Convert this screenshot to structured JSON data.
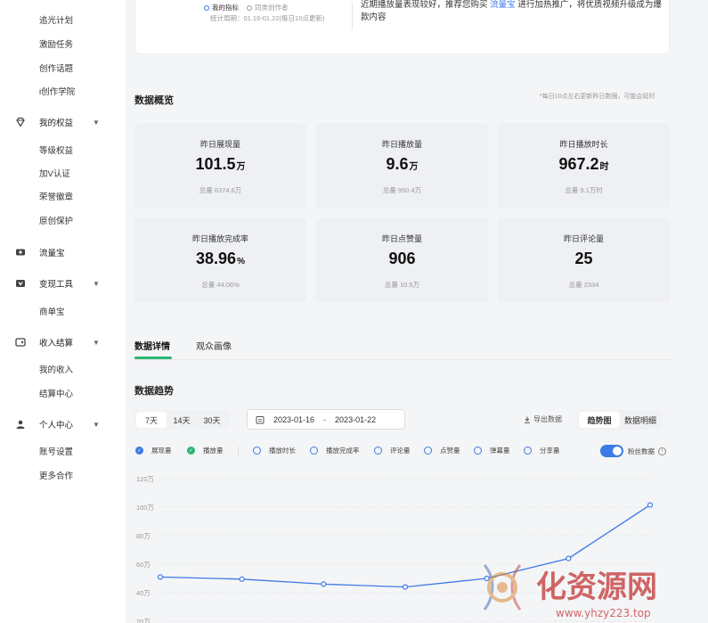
{
  "sidebar": {
    "items_top": [
      "追光计划",
      "激励任务",
      "创作话题",
      "i创作学院"
    ],
    "group_rights": "我的权益",
    "rights_items": [
      "等级权益",
      "加V认证",
      "荣誉徽章",
      "原创保护"
    ],
    "group_traffic": "流量宝",
    "group_monetize": "变现工具",
    "monetize_items": [
      "商单宝"
    ],
    "group_income": "收入结算",
    "income_items": [
      "我的收入",
      "结算中心"
    ],
    "group_personal": "个人中心",
    "personal_items": [
      "账号设置",
      "更多合作"
    ]
  },
  "top_card": {
    "option_mine": "我的指标",
    "option_peer": "同类创作者",
    "stat_period": "统计周期：01.16-01.22(每日10点更新)",
    "tip_prefix": "近期播放量表现较好，推荐您购买",
    "tip_link": "流量宝",
    "tip_suffix": "进行加热推广，将优质视频升级成为爆款内容"
  },
  "overview": {
    "title": "数据概览",
    "note": "*每日10点左右更新昨日数据，可能会延时",
    "metrics": [
      {
        "label": "昨日展现量",
        "value": "101.5",
        "unit": "万",
        "sub": "总量 6374.6万"
      },
      {
        "label": "昨日播放量",
        "value": "9.6",
        "unit": "万",
        "sub": "总量 950.4万"
      },
      {
        "label": "昨日播放时长",
        "value": "967.2",
        "unit": "时",
        "sub": "总量 9.1万时"
      },
      {
        "label": "昨日播放完成率",
        "value": "38.96",
        "unit": "%",
        "sub": "总量 44.06%"
      },
      {
        "label": "昨日点赞量",
        "value": "906",
        "unit": "",
        "sub": "总量 10.5万"
      },
      {
        "label": "昨日评论量",
        "value": "25",
        "unit": "",
        "sub": "总量 2334"
      }
    ]
  },
  "tabs": [
    "数据详情",
    "观众画像"
  ],
  "trend": {
    "title": "数据趋势",
    "ranges": [
      "7天",
      "14天",
      "30天"
    ],
    "date_start": "2023-01-16",
    "date_sep": "-",
    "date_end": "2023-01-22",
    "export": "导出数据",
    "views": [
      "趋势图",
      "数据明细"
    ],
    "metric_toggles": [
      "展现量",
      "播放量",
      "播放时长",
      "播放完成率",
      "评论量",
      "点赞量",
      "弹幕量",
      "分享量"
    ],
    "fan_data": "粉丝数据"
  },
  "colors": {
    "accent": "#3d7ae6",
    "green": "#2bb673"
  },
  "watermark": {
    "text": "化资源网",
    "url": "www.yhzy223.top"
  },
  "chart_data": {
    "type": "line",
    "y_ticks": [
      "120万",
      "100万",
      "80万",
      "60万",
      "40万",
      "20万"
    ],
    "ylim": [
      20,
      120
    ],
    "series": [
      {
        "values": [
          51,
          49.5,
          46,
          44,
          50,
          64,
          101.5
        ]
      }
    ]
  }
}
